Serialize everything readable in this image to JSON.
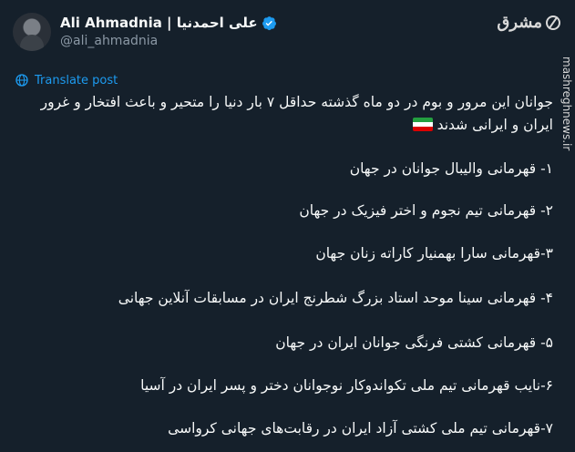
{
  "author": {
    "display_name": "Ali Ahmadnia | علی احمدنیا",
    "handle": "@ali_ahmadnia"
  },
  "watermark": {
    "logo_text": "مشرق",
    "side_text": "mashreghnews.ir"
  },
  "translate_label": "Translate post",
  "tweet": {
    "intro": "جوانان این مرور و بوم در دو ماه گذشته حداقل ۷ بار دنیا را متحیر و باعث افتخار و غرور ایران و ایرانی شدند",
    "items": [
      "۱- قهرمانی والیبال جوانان در جهان",
      "۲- قهرمانی تیم نجوم و اختر فیزیک در جهان",
      "۳-قهرمانی سارا بهمنیار کاراته زنان جهان",
      "۴- قهرمانی سینا موحد استاد بزرگ شطرنج ایران در مسابقات آنلاین جهانی",
      "۵- قهرمانی کشتی فرنگی جوانان ایران در جهان",
      "۶-نایب قهرمانی تیم ملی تکواندوکار نوجوانان دختر و پسر ایران در آسیا",
      "۷-قهرمانی تیم ملی کشتی آزاد ایران در رقابت‌های جهانی کرواسی"
    ]
  },
  "colors": {
    "background": "#15202b",
    "text": "#f7f9f9",
    "secondary": "#8b98a5",
    "link": "#1d9bf0",
    "verified": "#1d9bf0"
  }
}
